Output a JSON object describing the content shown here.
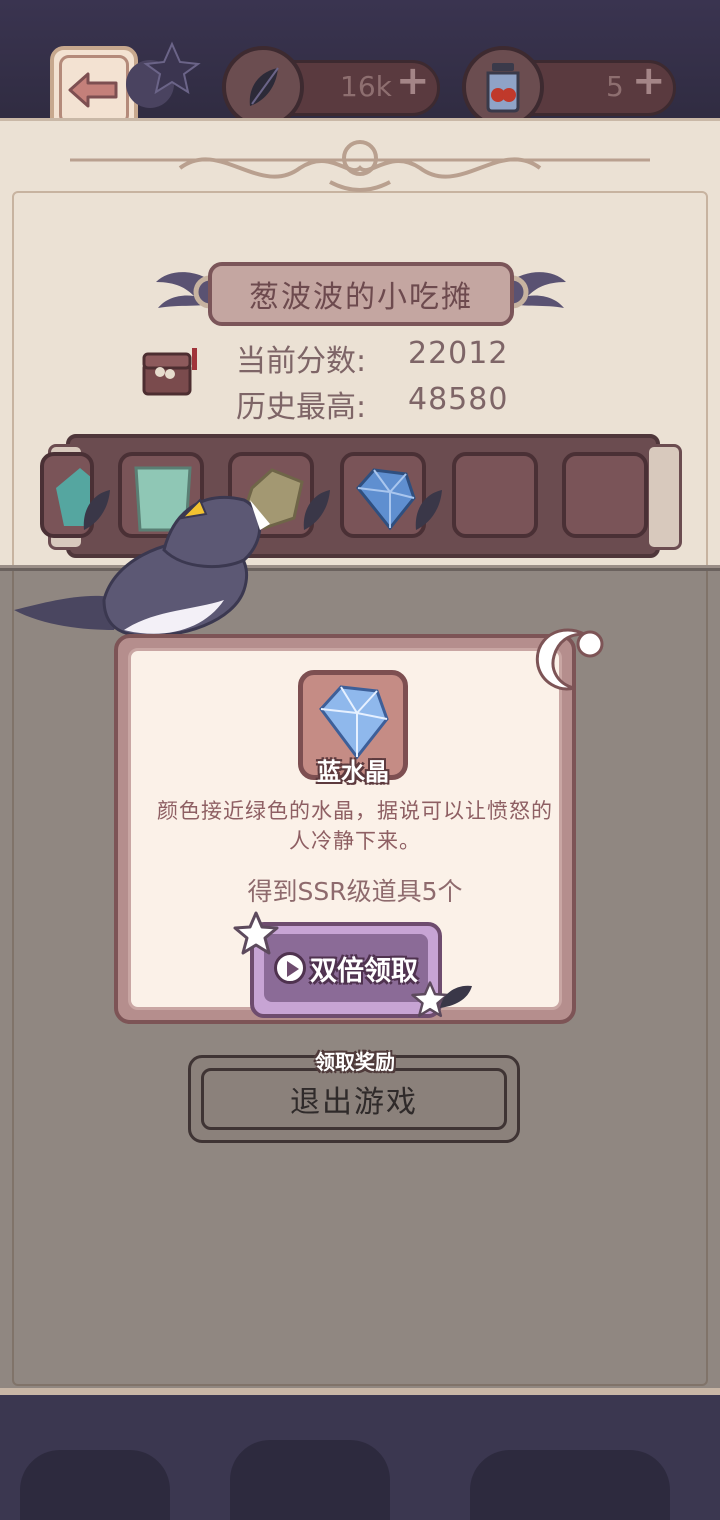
{
  "header": {
    "feathers": {
      "icon": "feather-icon",
      "value": "16k",
      "plus": "+"
    },
    "jars": {
      "icon": "jam-jar-icon",
      "value": "5",
      "plus": "+"
    }
  },
  "stall": {
    "title": "葱波波的小吃摊",
    "current_score_label": "当前分数:",
    "current_score": "22012",
    "best_score_label": "历史最高:",
    "best_score": "48580"
  },
  "slots": [
    {
      "item": "teal-crystal"
    },
    {
      "item": "green-crystal"
    },
    {
      "item": "olive-crystal"
    },
    {
      "item": "blue-crystal"
    },
    {
      "item": "empty"
    },
    {
      "item": "empty"
    }
  ],
  "reward_modal": {
    "item_name": "蓝水晶",
    "description": "颜色接近绿色的水晶，据说可以让愤怒的人冷静下来。",
    "reward_text": "得到SSR级道具5个",
    "double_button_label": "双倍领取"
  },
  "claim_label": "领取奖励",
  "exit_button_label": "退出游戏",
  "colors": {
    "parchment": "#ebe1d4",
    "modal_border": "#7d5456",
    "double_button": "#8b6b97",
    "text_brown": "#7e6567"
  }
}
